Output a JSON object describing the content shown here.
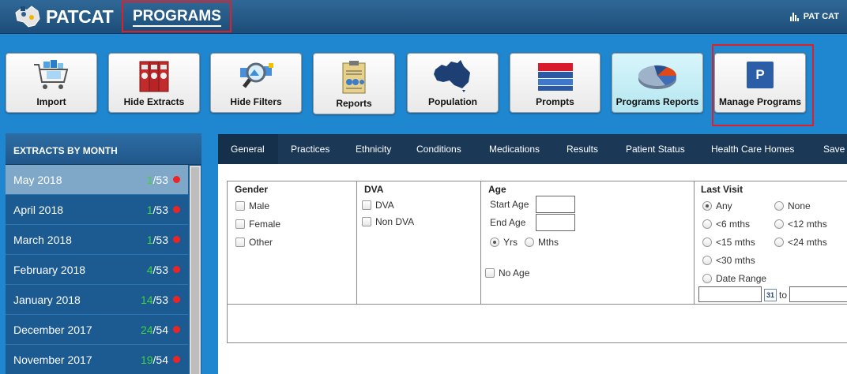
{
  "header": {
    "brand": "PATCAT",
    "section": "PROGRAMS",
    "user": "PAT CAT"
  },
  "toolbar": [
    {
      "label": "Import",
      "icon": "import-cart-icon"
    },
    {
      "label": "Hide Extracts",
      "icon": "binders-icon"
    },
    {
      "label": "Hide Filters",
      "icon": "magnifier-icon"
    },
    {
      "label": "Reports",
      "icon": "clipboard-icon"
    },
    {
      "label": "Population",
      "icon": "australia-map-icon"
    },
    {
      "label": "Prompts",
      "icon": "stack-icon"
    },
    {
      "label": "Programs Reports",
      "icon": "pie-chart-icon"
    },
    {
      "label": "Manage Programs",
      "icon": "programs-p-icon",
      "badge": "P"
    }
  ],
  "sidebar": {
    "title": "EXTRACTS BY MONTH",
    "months": [
      {
        "name": "May 2018",
        "count": "1",
        "total": "/53"
      },
      {
        "name": "April 2018",
        "count": "1",
        "total": "/53"
      },
      {
        "name": "March 2018",
        "count": "1",
        "total": "/53"
      },
      {
        "name": "February 2018",
        "count": "4",
        "total": "/53"
      },
      {
        "name": "January 2018",
        "count": "14",
        "total": "/53"
      },
      {
        "name": "December 2017",
        "count": "24",
        "total": "/54"
      },
      {
        "name": "November 2017",
        "count": "19",
        "total": "/54"
      }
    ]
  },
  "tabs": [
    "General",
    "Practices",
    "Ethnicity",
    "Conditions",
    "Medications",
    "Results",
    "Patient Status",
    "Health Care Homes",
    "Save"
  ],
  "filters": {
    "gender": {
      "title": "Gender",
      "options": [
        "Male",
        "Female",
        "Other"
      ]
    },
    "dva": {
      "title": "DVA",
      "options": [
        "DVA",
        "Non DVA"
      ]
    },
    "age": {
      "title": "Age",
      "start_label": "Start Age",
      "end_label": "End Age",
      "yrs": "Yrs",
      "mths": "Mths",
      "no_age": "No Age"
    },
    "last_visit": {
      "title": "Last Visit",
      "any": "Any",
      "none": "None",
      "lt6": "<6 mths",
      "lt12": "<12 mths",
      "lt15": "<15 mths",
      "lt24": "<24 mths",
      "lt30": "<30 mths",
      "range": "Date Range",
      "to": "to",
      "cal": "31"
    }
  },
  "colors": {
    "accent_red": "#e01f26",
    "header_bg": "#1d4d78",
    "page_bg": "#1f86d0",
    "count_green": "#3fd43f"
  }
}
